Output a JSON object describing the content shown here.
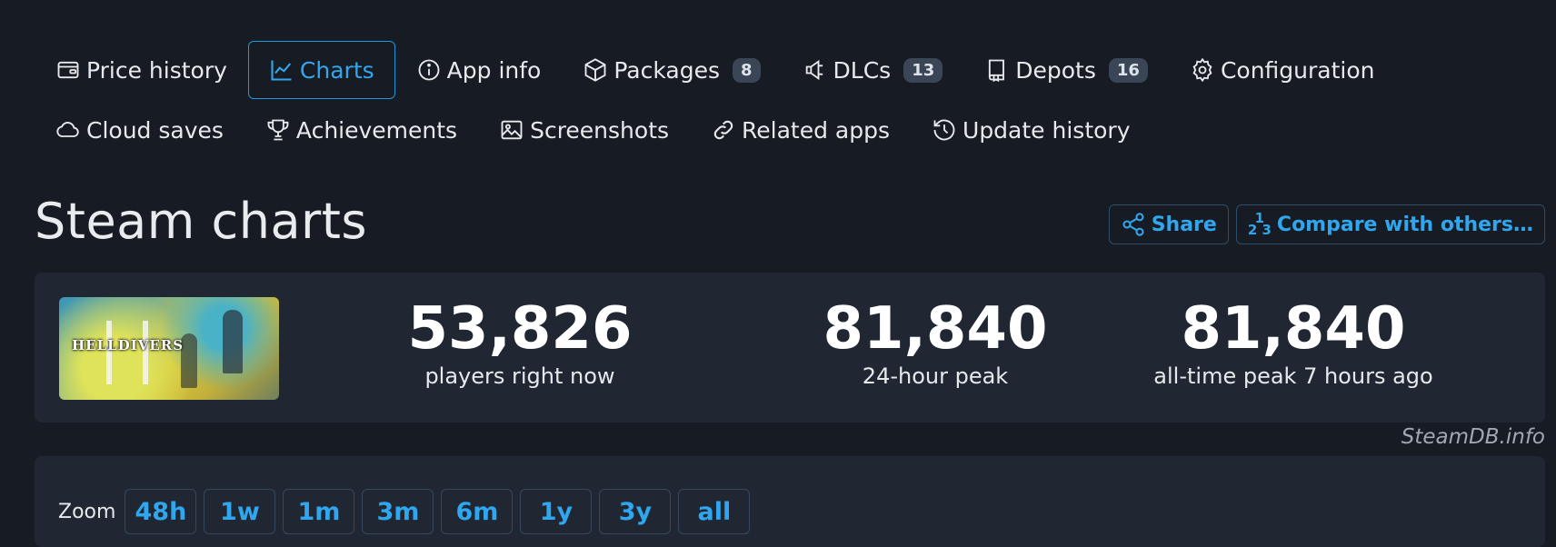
{
  "nav": {
    "row1": [
      {
        "label": "Price history",
        "icon": "wallet-icon"
      },
      {
        "label": "Charts",
        "icon": "chart-line-icon",
        "active": true
      },
      {
        "label": "App info",
        "icon": "info-icon"
      },
      {
        "label": "Packages",
        "icon": "package-icon",
        "badge": "8"
      },
      {
        "label": "DLCs",
        "icon": "plug-icon",
        "badge": "13"
      },
      {
        "label": "Depots",
        "icon": "book-icon",
        "badge": "16"
      },
      {
        "label": "Configuration",
        "icon": "gear-icon"
      }
    ],
    "row2": [
      {
        "label": "Cloud saves",
        "icon": "cloud-icon"
      },
      {
        "label": "Achievements",
        "icon": "trophy-icon"
      },
      {
        "label": "Screenshots",
        "icon": "image-icon"
      },
      {
        "label": "Related apps",
        "icon": "link-icon"
      },
      {
        "label": "Update history",
        "icon": "history-icon"
      }
    ]
  },
  "page_title": "Steam charts",
  "actions": {
    "share_label": "Share",
    "compare_label": "Compare with others…",
    "compare_fraction_top": "1",
    "compare_fraction_bottom": "2 3"
  },
  "game": {
    "logo_text": "HELLDIVERS"
  },
  "stats": [
    {
      "value": "53,826",
      "label": "players right now"
    },
    {
      "value": "81,840",
      "label": "24-hour peak"
    },
    {
      "value": "81,840",
      "label": "all-time peak 7 hours ago"
    }
  ],
  "credit": "SteamDB.info",
  "zoom": {
    "label": "Zoom",
    "options": [
      "48h",
      "1w",
      "1m",
      "3m",
      "6m",
      "1y",
      "3y",
      "all"
    ]
  },
  "colors": {
    "background": "#171b23",
    "panel": "#202733",
    "accent": "#2fa6ee",
    "badge": "#3a4555"
  }
}
